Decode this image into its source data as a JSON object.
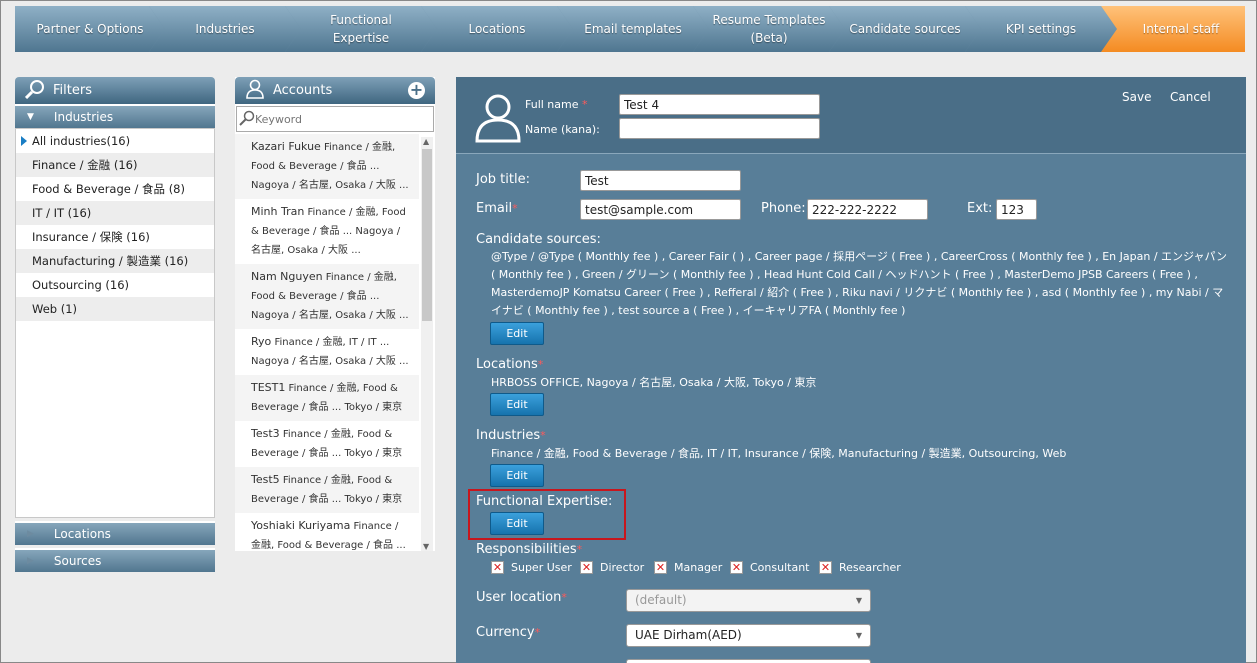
{
  "steps": [
    {
      "label": "Partner & Options"
    },
    {
      "label": "Industries"
    },
    {
      "label": "Functional\nExpertise"
    },
    {
      "label": "Locations"
    },
    {
      "label": "Email templates"
    },
    {
      "label": "Resume Templates\n(Beta)"
    },
    {
      "label": "Candidate sources"
    },
    {
      "label": "KPI settings"
    },
    {
      "label": "Internal staff"
    }
  ],
  "filters": {
    "title": "Filters",
    "industries_header": "Industries",
    "industries": [
      "All industries(16)",
      "Finance / 金融 (16)",
      "Food & Beverage / 食品 (8)",
      "IT / IT (16)",
      "Insurance / 保険 (16)",
      "Manufacturing / 製造業 (16)",
      "Outsourcing (16)",
      "Web (1)"
    ],
    "locations_header": "Locations",
    "sources_header": "Sources"
  },
  "accounts": {
    "title": "Accounts",
    "add_label": "+",
    "keyword_placeholder": "Keyword",
    "items": [
      {
        "name": "Kazari Fukue",
        "detail": " Finance / 金融, Food & Beverage / 食品 ... Nagoya / 名古屋, Osaka / 大阪 ..."
      },
      {
        "name": "Minh Tran",
        "detail": " Finance / 金融, Food & Beverage / 食品 ... Nagoya / 名古屋, Osaka / 大阪 ..."
      },
      {
        "name": "Nam Nguyen",
        "detail": " Finance / 金融, Food & Beverage / 食品 ... Nagoya / 名古屋, Osaka / 大阪 ..."
      },
      {
        "name": "Ryo",
        "detail": " Finance / 金融, IT / IT ... Nagoya / 名古屋, Osaka / 大阪 ..."
      },
      {
        "name": "TEST1",
        "detail": " Finance / 金融, Food & Beverage / 食品 ... Tokyo / 東京"
      },
      {
        "name": "Test3",
        "detail": " Finance / 金融, Food & Beverage / 食品 ... Tokyo / 東京"
      },
      {
        "name": "Test5",
        "detail": " Finance / 金融, Food & Beverage / 食品 ... Tokyo / 東京"
      },
      {
        "name": "Yoshiaki Kuriyama",
        "detail": " Finance / 金融, Food & Beverage / 食品 ..."
      }
    ]
  },
  "form": {
    "full_name_label": "Full name",
    "full_name_value": "Test 4",
    "kana_label": "Name (kana):",
    "kana_value": "",
    "save_label": "Save",
    "cancel_label": "Cancel",
    "job_title_label": "Job title:",
    "job_title_value": "Test",
    "email_label": "Email",
    "email_value": "test@sample.com",
    "phone_label": "Phone:",
    "phone_value": "222-222-2222",
    "ext_label": "Ext:",
    "ext_value": "123",
    "candidate_sources_label": "Candidate sources:",
    "candidate_sources_value": "@Type / @Type ( Monthly fee ) , Career Fair ( ) , Career page / 採用ページ ( Free ) , CareerCross ( Monthly fee ) , En Japan / エンジャパン ( Monthly fee ) , Green / グリーン ( Monthly fee ) , Head Hunt Cold Call / ヘッドハント ( Free ) , MasterDemo JPSB Careers ( Free ) , MasterdemoJP Komatsu Career ( Free ) , Refferal / 紹介 ( Free ) , Riku navi / リクナビ ( Monthly fee ) , asd ( Monthly fee ) , my Nabi / マイナビ ( Monthly fee ) , test source a ( Free ) , イーキャリアFA ( Monthly fee )",
    "locations_label": "Locations",
    "locations_value": "HRBOSS OFFICE, Nagoya / 名古屋, Osaka / 大阪, Tokyo / 東京",
    "industries_label": "Industries",
    "industries_value": "Finance / 金融, Food & Beverage / 食品, IT / IT, Insurance / 保険, Manufacturing / 製造業, Outsourcing, Web",
    "functional_label": "Functional Expertise:",
    "edit_label": "Edit",
    "responsibilities_label": "Responsibilities",
    "responsibilities": [
      "Super User",
      "Director",
      "Manager",
      "Consultant",
      "Researcher"
    ],
    "user_location_label": "User location",
    "user_location_value": "(default)",
    "currency_label": "Currency",
    "currency_value": "UAE Dirham(AED)",
    "required_mark": "*"
  }
}
